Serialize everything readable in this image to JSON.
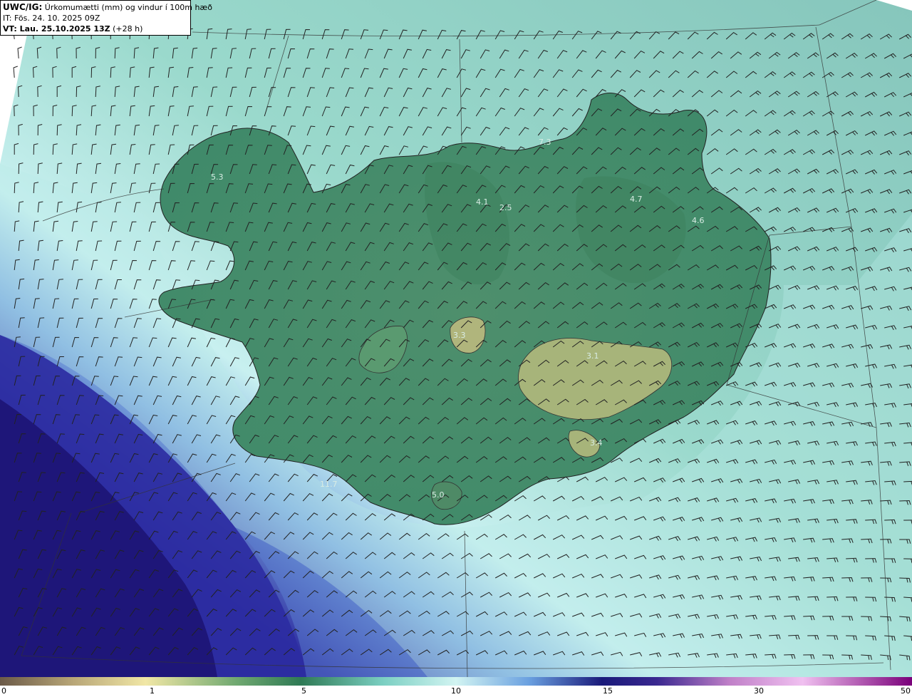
{
  "header": {
    "code": "UWC/IG:",
    "title": "Úrkomumætti (mm) og vindur í 100m hæð",
    "issue_time": "IT: Fös. 24. 10. 2025 09Z",
    "valid_prefix": "VT: Lau. 25.10.2025 13Z",
    "valid_suffix": "(+28 h)"
  },
  "map_labels": [
    {
      "text": "5.3"
    },
    {
      "text": "4.1"
    },
    {
      "text": "2.5"
    },
    {
      "text": "7.3"
    },
    {
      "text": "4.7"
    },
    {
      "text": "4.6"
    },
    {
      "text": "3.3"
    },
    {
      "text": "3.1"
    },
    {
      "text": "3.4"
    },
    {
      "text": "5.0"
    },
    {
      "text": "11.7"
    }
  ],
  "colorbar": {
    "ticks": [
      "0",
      "1",
      "5",
      "10",
      "15",
      "30",
      "50"
    ],
    "colors": [
      "#7a6650",
      "#c7b98a",
      "#f6e9a6",
      "#2f7a55",
      "#8fd6cf",
      "#cfeff0",
      "#3a3ab0",
      "#1a1a7a",
      "#c06bc0",
      "#e8b4e8",
      "#800080"
    ]
  },
  "colors": {
    "land_low": "#3f8a6a",
    "land_high": "#a4b378",
    "sea_near": "#8ed3c8",
    "sea_far": "#c9f2ee",
    "heavy_precip": "#2b2b9a",
    "heaviest_precip": "#1c1070"
  }
}
